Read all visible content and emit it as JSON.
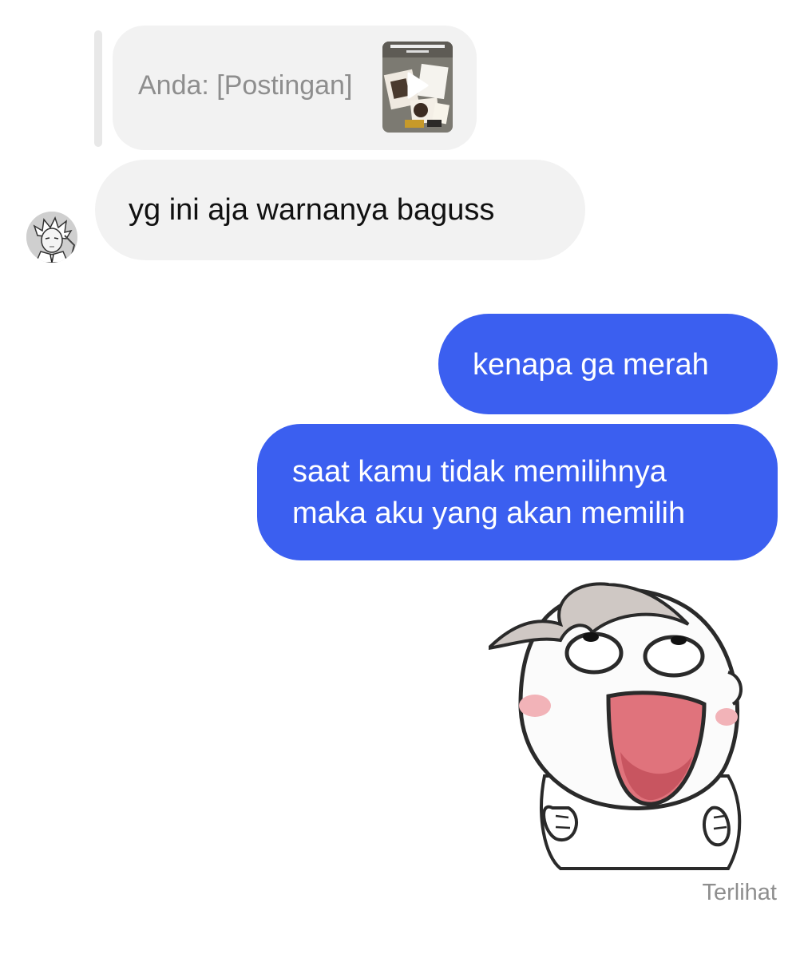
{
  "colors": {
    "background": "#ffffff",
    "incoming_bubble": "#f2f2f2",
    "outgoing_bubble": "#3b5ff0",
    "muted_text": "#8e8e8e"
  },
  "reply_preview": {
    "text": "Anda: [Postingan]",
    "thumbnail_icon": "play-icon"
  },
  "incoming_message": {
    "text": "yg ini aja warnanya baguss",
    "avatar_icon": "avatar"
  },
  "outgoing_messages": [
    {
      "lines": [
        "kenapa ga merah"
      ]
    },
    {
      "lines": [
        "saat kamu tidak memilihnya",
        "maka aku yang akan memilih"
      ]
    }
  ],
  "sticker": {
    "icon": "laughing-cartoon-sticker"
  },
  "status": {
    "seen_label": "Terlihat"
  }
}
